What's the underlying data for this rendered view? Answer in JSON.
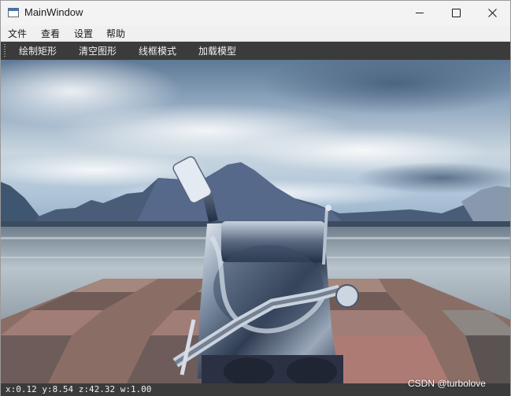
{
  "window": {
    "title": "MainWindow"
  },
  "menubar": {
    "items": [
      "文件",
      "查看",
      "设置",
      "帮助"
    ]
  },
  "toolbar": {
    "buttons": [
      "绘制矩形",
      "清空图形",
      "线框模式",
      "加载模型"
    ]
  },
  "status": {
    "coords": "x:0.12 y:8.54 z:42.32 w:1.00"
  },
  "watermark": "CSDN @turbolove",
  "colors": {
    "toolbar_bg": "#3b3b3b",
    "titlebar_bg": "#f3f3f3",
    "menubar_bg": "#f0f0f0"
  },
  "icons": {
    "app": "window-app-icon",
    "minimize": "minimize-icon",
    "maximize": "maximize-icon",
    "close": "close-icon"
  }
}
